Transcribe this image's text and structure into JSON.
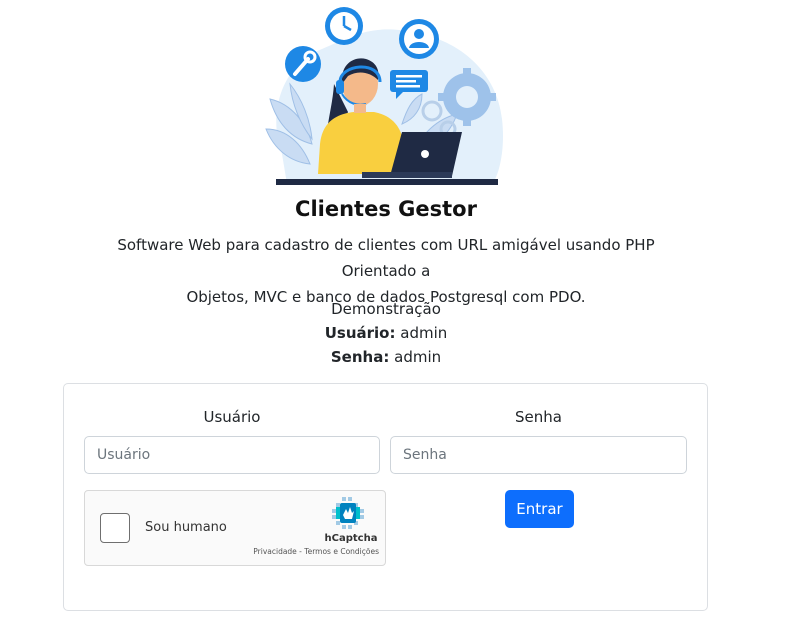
{
  "header": {
    "title": "Clientes Gestor",
    "description_line1": "Software Web para cadastro de clientes com URL amigável usando PHP Orientado a",
    "description_line2": "Objetos, MVC e banco de dados Postgresql com PDO."
  },
  "demo": {
    "heading": "Demonstração",
    "user_label": "Usuário:",
    "user_value": "admin",
    "pass_label": "Senha:",
    "pass_value": "admin"
  },
  "form": {
    "user_label": "Usuário",
    "user_placeholder": "Usuário",
    "pass_label": "Senha",
    "pass_placeholder": "Senha",
    "submit_label": "Entrar"
  },
  "captcha": {
    "label": "Sou humano",
    "brand": "hCaptcha",
    "links": "Privacidade - Termos e Condições"
  },
  "icons": {
    "hero": "customer-support-illustration",
    "captcha_logo": "hcaptcha-logo-icon"
  },
  "colors": {
    "primary": "#0d6efd",
    "illustration_blue": "#1e88e5",
    "illustration_yellow": "#f9cf3f"
  }
}
